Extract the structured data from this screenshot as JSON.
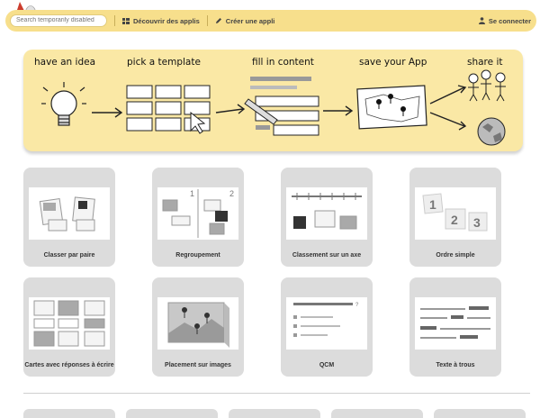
{
  "nav": {
    "search_placeholder": "Search temporarily disabled",
    "discover": "Découvrir des applis",
    "create": "Créer une appli",
    "login": "Se connecter"
  },
  "hero": {
    "steps": [
      "have an idea",
      "pick a template",
      "fill in content",
      "save your App",
      "share it"
    ]
  },
  "templates": [
    {
      "title": "Classer par paire",
      "icon": "pairs-icon"
    },
    {
      "title": "Regroupement",
      "icon": "grouping-icon"
    },
    {
      "title": "Classement sur un axe",
      "icon": "timeline-icon"
    },
    {
      "title": "Ordre simple",
      "icon": "ordering-icon"
    },
    {
      "title": "Cartes avec réponses à écrire",
      "icon": "cards-icon"
    },
    {
      "title": "Placement sur images",
      "icon": "image-pins-icon"
    },
    {
      "title": "QCM",
      "icon": "quiz-icon"
    },
    {
      "title": "Texte à trous",
      "icon": "gap-text-icon"
    }
  ],
  "colors": {
    "navbar": "#f7df8c",
    "hero": "#fae8a5",
    "card": "#dcdcdc",
    "accent_link": "#8ea6d0"
  }
}
